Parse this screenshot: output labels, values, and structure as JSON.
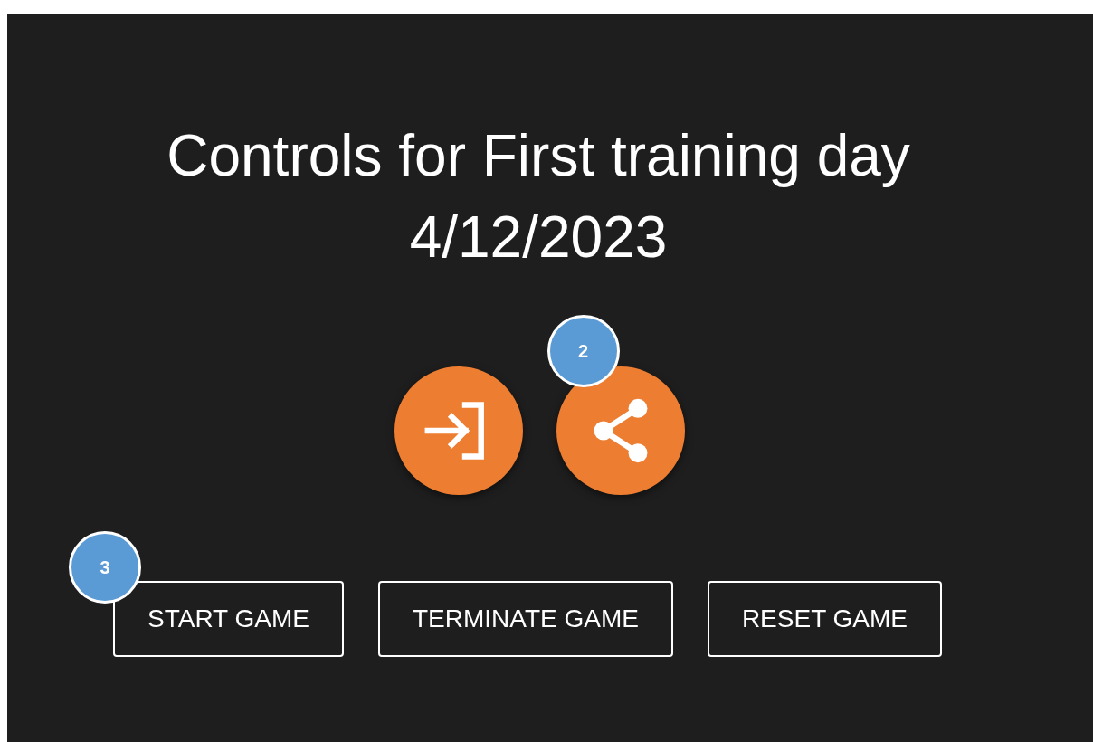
{
  "title": [
    "Controls for First training day",
    "4/12/2023"
  ],
  "actions": [
    {
      "kind": "sign-in"
    },
    {
      "kind": "share",
      "badge": "2"
    }
  ],
  "buttons": [
    {
      "label": "START GAME",
      "badge": "3"
    },
    {
      "label": "TERMINATE GAME"
    },
    {
      "label": "RESET GAME"
    }
  ]
}
